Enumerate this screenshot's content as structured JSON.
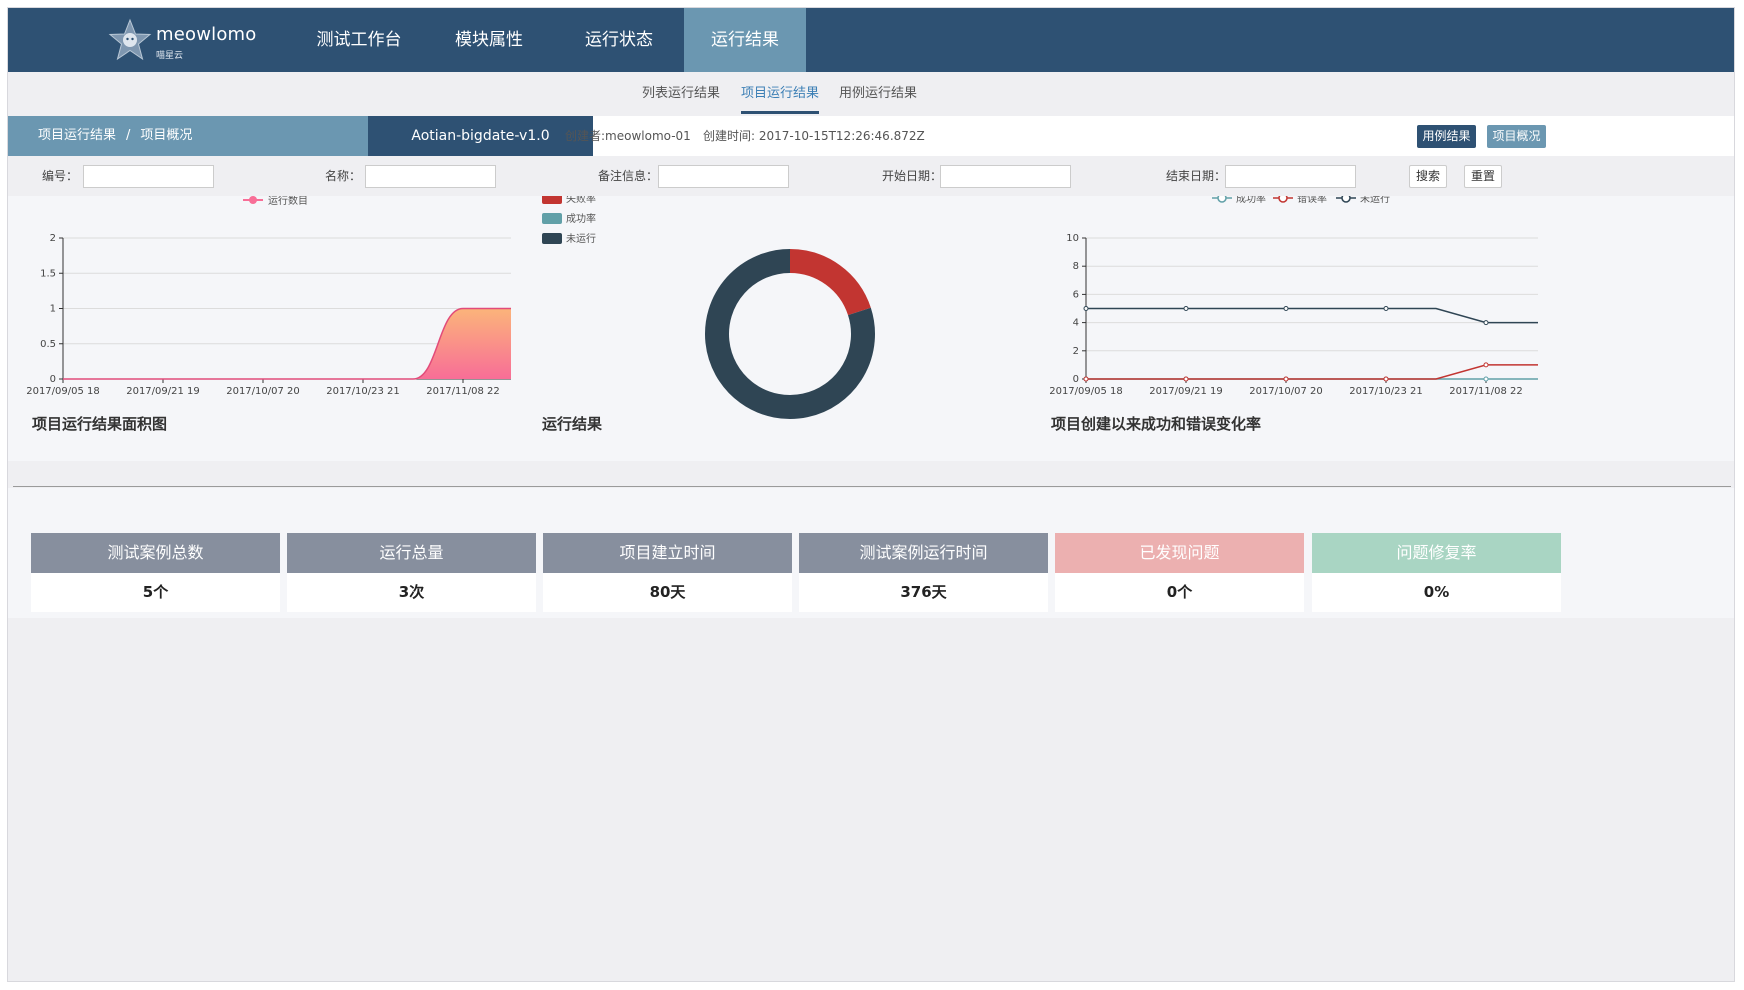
{
  "brand": {
    "name": "meowlomo",
    "sub": "喵星云"
  },
  "nav": {
    "items": [
      {
        "label": "测试工作台"
      },
      {
        "label": "模块属性"
      },
      {
        "label": "运行状态"
      },
      {
        "label": "运行结果"
      }
    ],
    "active_index": 3
  },
  "subtabs": {
    "items": [
      {
        "label": "列表运行结果"
      },
      {
        "label": "项目运行结果"
      },
      {
        "label": "用例运行结果"
      }
    ],
    "active_index": 1
  },
  "header": {
    "breadcrumb_1": "项目运行结果",
    "breadcrumb_sep": "/",
    "breadcrumb_2": "项目概况",
    "project_name": "Aotian-bigdate-v1.0",
    "creator": "创建者:meowlomo-01",
    "created_time": "创建时间: 2017-10-15T12:26:46.872Z",
    "btn_case_result": "用例结果",
    "btn_project_overview": "项目概况"
  },
  "filters": {
    "id_label": "编号：",
    "name_label": "名称：",
    "note_label": "备注信息：",
    "start_label": "开始日期：",
    "end_label": "结束日期：",
    "search_btn": "搜索",
    "reset_btn": "重置"
  },
  "colors": {
    "nav_bg": "#2e5173",
    "nav_active": "#6b97b1",
    "fail": "#c23531",
    "success": "#61a0a8",
    "not_run": "#2f4554",
    "area_pink": "#f86e97",
    "area_orange": "#fbb47a",
    "card_gray": "#878f9e",
    "card_pink": "#ecb0b0",
    "card_green": "#a9d5c3",
    "btn_dark": "#2e5173",
    "btn_light": "#6b97b1"
  },
  "chart_data": [
    {
      "type": "area",
      "title": "项目运行结果面积图",
      "legend": [
        "运行数目"
      ],
      "categories": [
        "2017/09/05 18",
        "2017/09/21 19",
        "2017/10/07 20",
        "2017/10/23 21",
        "2017/11/08 22"
      ],
      "series": [
        {
          "name": "运行数目",
          "values": [
            0,
            0,
            0,
            0,
            0,
            1
          ]
        }
      ],
      "x": [
        "2017/09/05 18",
        "2017/09/21 19",
        "2017/10/07 20",
        "2017/10/23 21",
        "",
        "2017/11/08 22"
      ],
      "yticks": [
        "0",
        "0.5",
        "1",
        "1.5",
        "2"
      ],
      "ylim": [
        0,
        2
      ]
    },
    {
      "type": "pie",
      "title": "运行结果",
      "legend": [
        "失败率",
        "成功率",
        "未运行"
      ],
      "series": [
        {
          "name": "失败率",
          "value": 20
        },
        {
          "name": "成功率",
          "value": 0
        },
        {
          "name": "未运行",
          "value": 80
        }
      ]
    },
    {
      "type": "line",
      "title": "项目创建以来成功和错误变化率",
      "legend": [
        "成功率",
        "错误率",
        "未运行"
      ],
      "categories": [
        "2017/09/05 18",
        "2017/09/21 19",
        "2017/10/07 20",
        "2017/10/23 21",
        "2017/11/08 22"
      ],
      "series": [
        {
          "name": "成功率",
          "values": [
            0,
            0,
            0,
            0,
            0,
            0
          ]
        },
        {
          "name": "错误率",
          "values": [
            0,
            0,
            0,
            0,
            1,
            1
          ]
        },
        {
          "name": "未运行",
          "values": [
            5,
            5,
            5,
            5,
            4,
            4
          ]
        }
      ],
      "yticks": [
        "0",
        "2",
        "4",
        "6",
        "8",
        "10"
      ],
      "ylim": [
        0,
        10
      ]
    }
  ],
  "stats": [
    {
      "label": "测试案例总数",
      "value": "5个"
    },
    {
      "label": "运行总量",
      "value": "3次"
    },
    {
      "label": "项目建立时间",
      "value": "80天"
    },
    {
      "label": "测试案例运行时间",
      "value": "376天"
    },
    {
      "label": "已发现问题",
      "value": "0个"
    },
    {
      "label": "问题修复率",
      "value": "0%"
    }
  ]
}
